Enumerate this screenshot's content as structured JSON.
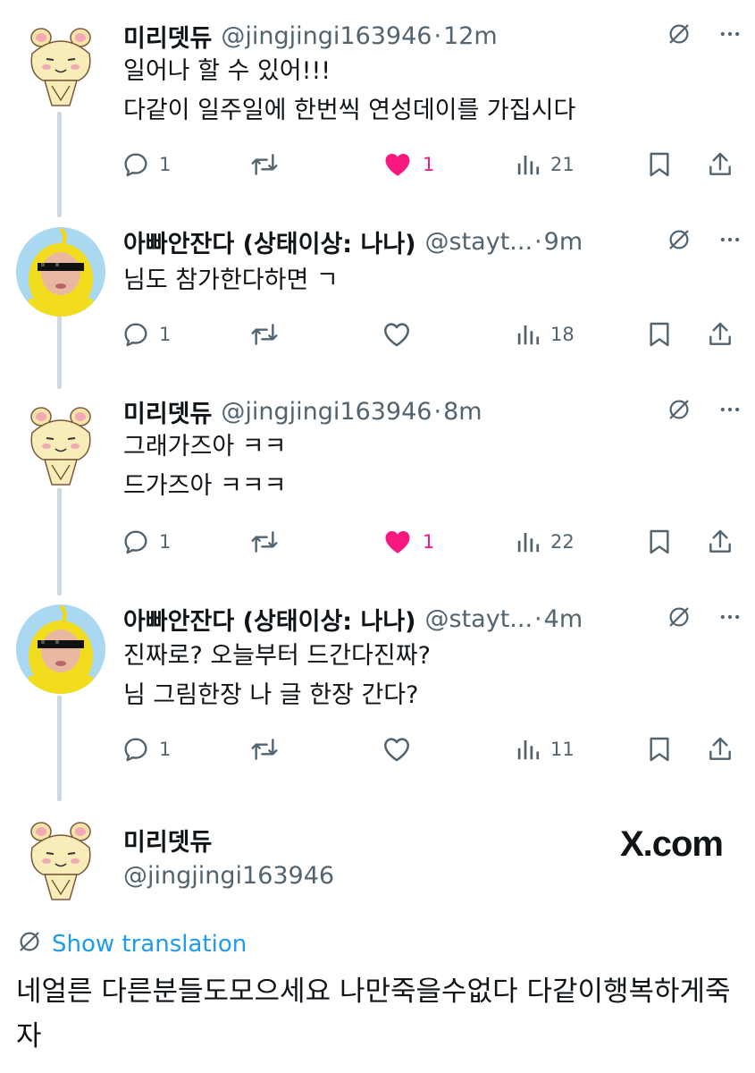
{
  "tweets": [
    {
      "author": "미리뎃듀",
      "handle": "@jingjingi163946",
      "sep": "·",
      "time": "12m",
      "lines": [
        "일어나 할 수 있어!!!",
        "다같이 일주일에 한번씩 연성데이를 가집시다"
      ],
      "replies": "1",
      "likes": "1",
      "liked": true,
      "views": "21",
      "avatar": "bear-avatar"
    },
    {
      "author": "아빠안잔다 (상태이상: 나나)",
      "handle": "@stayt...",
      "sep": "·",
      "time": "9m",
      "lines": [
        "님도 참가한다하면 ㄱ"
      ],
      "replies": "1",
      "likes": "",
      "liked": false,
      "views": "18",
      "avatar": "yellow-teletubby-avatar"
    },
    {
      "author": "미리뎃듀",
      "handle": "@jingjingi163946",
      "sep": "·",
      "time": "8m",
      "lines": [
        "그래가즈아 ㅋㅋ",
        "드가즈아 ㅋㅋㅋ"
      ],
      "replies": "1",
      "likes": "1",
      "liked": true,
      "views": "22",
      "avatar": "bear-avatar"
    },
    {
      "author": "아빠안잔다 (상태이상: 나나)",
      "handle": "@stayt...",
      "sep": "·",
      "time": "4m",
      "lines": [
        "진짜로? 오늘부터 드간다진짜?",
        "님 그림한장 나 글 한장 간다?"
      ],
      "replies": "1",
      "likes": "",
      "liked": false,
      "views": "11",
      "avatar": "yellow-teletubby-avatar"
    }
  ],
  "main": {
    "author": "미리뎃듀",
    "handle": "@jingjingi163946",
    "brand": "X.com",
    "translate_label": "Show translation",
    "text": "네얼른 다른분들도모으세요 나만죽을수없다 다같이행복하게죽자"
  },
  "colors": {
    "like": "#f91880",
    "link": "#1d9bf0",
    "muted": "#536471",
    "line": "#cfd9de"
  }
}
